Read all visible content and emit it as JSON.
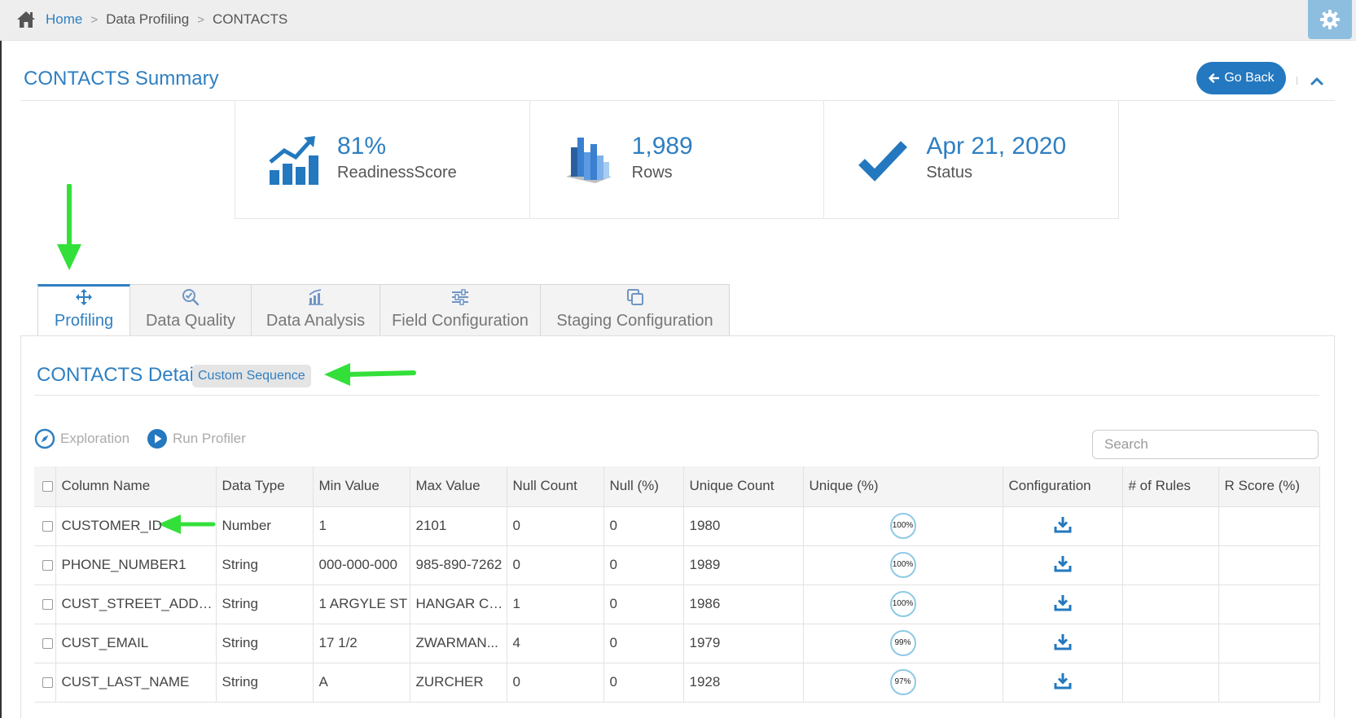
{
  "breadcrumb": {
    "home": "Home",
    "section": "Data Profiling",
    "current": "CONTACTS"
  },
  "summary": {
    "title": "CONTACTS Summary",
    "go_back": "Go Back",
    "stats": [
      {
        "value": "81%",
        "label": "ReadinessScore",
        "icon": "trend-chart-icon"
      },
      {
        "value": "1,989",
        "label": "Rows",
        "icon": "bar-chart-icon"
      },
      {
        "value": "Apr 21, 2020",
        "label": "Status",
        "icon": "checkmark-icon"
      }
    ]
  },
  "tabs": [
    {
      "label": "Profiling",
      "icon": "move-arrows-icon",
      "active": true
    },
    {
      "label": "Data Quality",
      "icon": "magnify-check-icon",
      "active": false
    },
    {
      "label": "Data Analysis",
      "icon": "analysis-icon",
      "active": false
    },
    {
      "label": "Field Configuration",
      "icon": "sliders-icon",
      "active": false
    },
    {
      "label": "Staging Configuration",
      "icon": "copy-icon",
      "active": false
    }
  ],
  "detail": {
    "title": "CONTACTS Detail",
    "custom_sequence": "Custom Sequence",
    "actions": {
      "exploration": "Exploration",
      "run_profiler": "Run Profiler"
    },
    "search_placeholder": "Search"
  },
  "table": {
    "headers": [
      "Column Name",
      "Data Type",
      "Min Value",
      "Max Value",
      "Null Count",
      "Null (%)",
      "Unique Count",
      "Unique (%)",
      "Configuration",
      "# of Rules",
      "R Score (%)"
    ],
    "rows": [
      {
        "column": "CUSTOMER_ID",
        "type": "Number",
        "min": "1",
        "max": "2101",
        "null_count": "0",
        "null_pct": "0",
        "unique_count": "1980",
        "unique_pct": "100%"
      },
      {
        "column": "PHONE_NUMBER1",
        "type": "String",
        "min": "000-000-000",
        "max": "985-890-7262",
        "null_count": "0",
        "null_pct": "0",
        "unique_count": "1989",
        "unique_pct": "100%"
      },
      {
        "column": "CUST_STREET_ADDRES...",
        "type": "String",
        "min": "1 ARGYLE ST",
        "max": "HANGAR CE...",
        "null_count": "1",
        "null_pct": "0",
        "unique_count": "1986",
        "unique_pct": "100%"
      },
      {
        "column": "CUST_EMAIL",
        "type": "String",
        "min": "17 1/2",
        "max": "ZWARMAN...",
        "null_count": "4",
        "null_pct": "0",
        "unique_count": "1979",
        "unique_pct": "99%"
      },
      {
        "column": "CUST_LAST_NAME",
        "type": "String",
        "min": "A",
        "max": "ZURCHER",
        "null_count": "0",
        "null_pct": "0",
        "unique_count": "1928",
        "unique_pct": "97%"
      }
    ]
  },
  "colors": {
    "accent": "#2f7fc1",
    "button": "#2378bf",
    "annotation_arrow": "#33e03a",
    "gear_bg": "#8ebedf"
  }
}
